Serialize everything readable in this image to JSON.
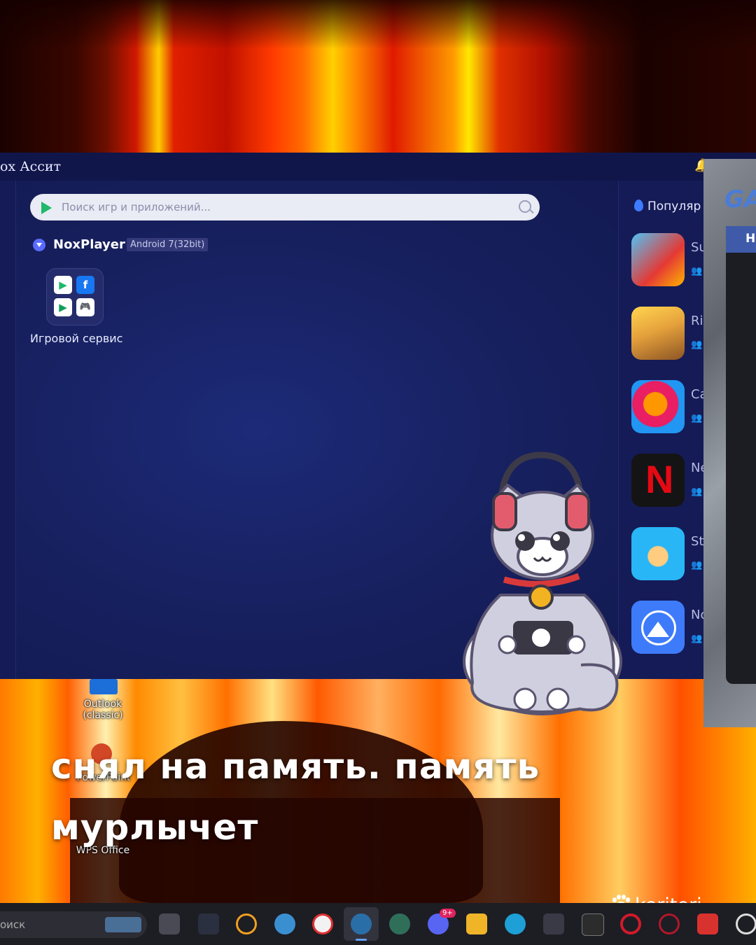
{
  "window": {
    "title": "ox Ассит",
    "search_placeholder": "Поиск игр и приложений...",
    "emulator": {
      "name": "NoxPlayer",
      "android_version": "Android 7(32bit)"
    },
    "apps": [
      {
        "label": "Игровой сервис",
        "icon": "game-service-folder-icon"
      }
    ]
  },
  "sidebar": {
    "heading": "Популяр",
    "games": [
      {
        "name": "Su",
        "icon": "subway-surfers-icon"
      },
      {
        "name": "Ri",
        "icon": "rise-of-kingdoms-icon"
      },
      {
        "name": "Ca",
        "icon": "candy-crush-icon"
      },
      {
        "name": "Ne",
        "icon": "netflix-icon"
      },
      {
        "name": "St",
        "icon": "stumble-guys-icon"
      },
      {
        "name": "No",
        "icon": "nordvpn-icon"
      }
    ]
  },
  "side_panel": {
    "logo_text": "GA",
    "tab_text": "Н"
  },
  "desktop": {
    "icons": [
      {
        "label_line1": "Outlook",
        "label_line2": "(classic)"
      },
      {
        "label_line1": "PowerPoint",
        "label_line2": ""
      },
      {
        "label_line1": "WPS Office",
        "label_line2": ""
      }
    ]
  },
  "caption": {
    "line1": "снял на память. память",
    "line2": "мурлычет"
  },
  "brand": "keriteri",
  "taskbar": {
    "search_text": "оиск",
    "notification_badge": "9+",
    "apps": [
      "task-view-icon",
      "wave-icon",
      "osu-icon",
      "telegram-icon",
      "yandex-browser-icon",
      "steam-icon",
      "gps-app-icon",
      "discord-icon",
      "file-explorer-icon",
      "edge-icon",
      "store-icon",
      "epic-games-icon",
      "opera-icon",
      "opera-gx-icon",
      "wps-icon",
      "settings-icon"
    ]
  },
  "colors": {
    "window_bg": "#161b54",
    "titlebar_bg": "#10164a",
    "caption": "#ffffff",
    "taskbar_bg": "#1d1d24"
  }
}
